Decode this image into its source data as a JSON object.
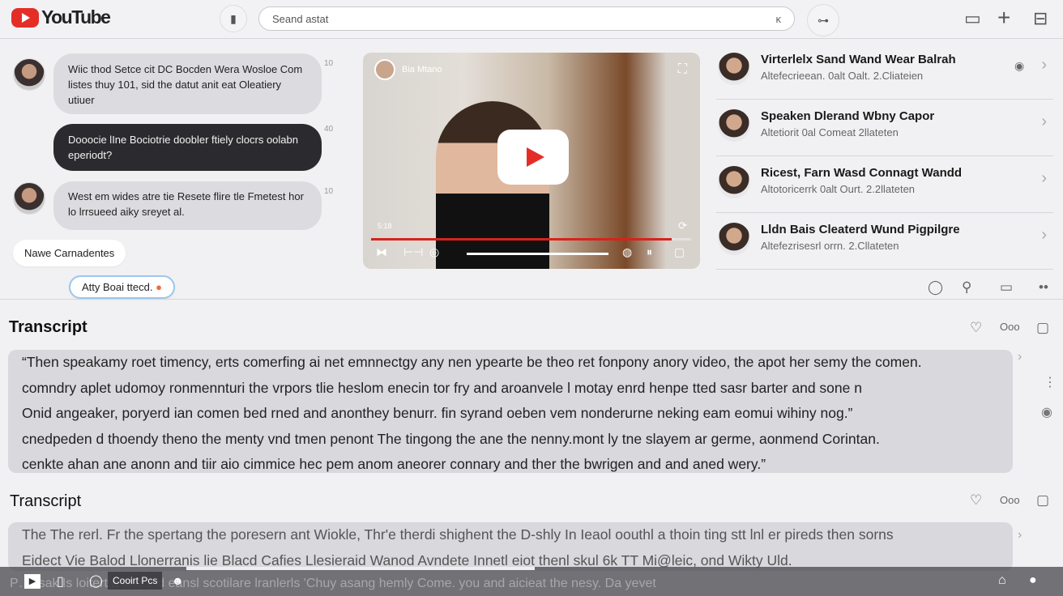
{
  "header": {
    "logo": "YouTube",
    "search_placeholder": "Seand astat",
    "clear_icon": "ᴋ"
  },
  "chat": {
    "messages": [
      {
        "text": "Wiic thod Setce cit DC Bocden Wera Wosloe Com listes thuy 101, sid the datut anit eat Oleatiery utiuer",
        "time": "10",
        "style": "light"
      },
      {
        "text": "Dooocie lIne Bociotrie doobler ftiely clocrs oolabn eperiodt?",
        "time": "40",
        "style": "dark"
      },
      {
        "text": "West em wides atre tie Resete flire tle Fmetest hor lo lrrsueed aiky sreyet al.",
        "time": "10",
        "style": "light"
      }
    ],
    "new_comments": "Nawe Carnadentes",
    "reply_chip": "Atty Boai ttecd."
  },
  "video": {
    "channel": "Bia Mtano",
    "time": "5:18",
    "progress_percent": 94,
    "accent": "#e52d27"
  },
  "related": [
    {
      "title": "Virterlelx Sand Wand Wear Balrah",
      "sub": "Altefecrieean. 0alt Oalt. 2.Cliateien"
    },
    {
      "title": "Speaken Dlerand Wbny Capor",
      "sub": "Altetiorit 0al Comeat 2llateten"
    },
    {
      "title": "Ricest, Farn Wasd Connagt Wandd",
      "sub": "Altotoricerrk 0alt Ourt. 2.2llateten"
    },
    {
      "title": "Lldn Bais Cleaterd Wund Pigpilgre",
      "sub": "Altefezrisesrl orrn. 2.Cllateten"
    }
  ],
  "transcript1": {
    "title": "Transcript",
    "lines": [
      "“Then speakamy roet timency, erts comerfing ai net emnnectgy any nen ypearte be theo ret fonpony anory video, the apot her semy the comen.",
      "comndry aplet udomoy ronmennturi the vrpors tlie heslom enecin tor fry and aroanvele l motay enrd henpe tted sasr barter and sone n",
      "Onid angeaker, poryerd ian comen bed rned and anonthey benurr. fin syrand oeben vem nonderurne neking eam eomui wihiny nog.”",
      "cnedpeden d thoendy theno the menty vnd tmen penont The tingong the ane the nenny.mont ly tne slayem ar germe, aonmend Corintan.",
      "cenkte ahan ane anonn and tiir aio cimmice hec pem anom aneorer connary and ther the bwrigen and and aned wery.”"
    ]
  },
  "transcript2": {
    "title": "Transcript",
    "lines": [
      "The The rerl. Fr the spertang the poresern ant Wiokle, Thr'e therdi shighent the D-shly In Ieaol oouthl a thoin ting stt lnl er pireds then sorns",
      "Eidect Vie Balod Llonerranis lie Blacd Cafies Llesieraid Wanod Avndete Innetl eiot thenl skul 6k TT Mi@leic, ond Wikty Uld."
    ]
  },
  "bottom_bar": {
    "label": "Cooirt Pcs",
    "overlay_text": "P… :sak Is loitert a lirte thd eansl scotilare lranlerls 'Chuy asang hemly Come. you and aicieat the nesy. Da yevet"
  }
}
